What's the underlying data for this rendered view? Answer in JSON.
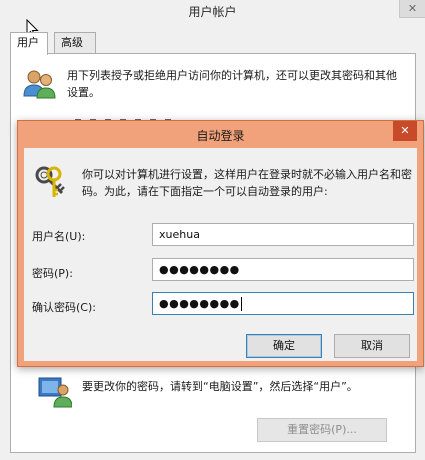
{
  "background_window": {
    "title": "用户帐户",
    "close_glyph": "✕",
    "tabs": [
      {
        "label": "用户",
        "active": true
      },
      {
        "label": "高级",
        "active": false
      }
    ],
    "info_text": "用下列表授予或拒绝用户访问你的计算机，还可以更改其密码和其他设置。",
    "password_text": "要更改你的密码，请转到“电脑设置”，然后选择“用户”。",
    "reset_button_label": "重置密码(P)..."
  },
  "dialog": {
    "title": "自动登录",
    "close_glyph": "✕",
    "description": "你可以对计算机进行设置，这样用户在登录时就不必输入用户名和密码。为此，请在下面指定一个可以自动登录的用户:",
    "fields": {
      "username": {
        "label": "用户名(U):",
        "value": "xuehua"
      },
      "password": {
        "label": "密码(P):",
        "value": "●●●●●●●●"
      },
      "confirm": {
        "label": "确认密码(C):",
        "value": "●●●●●●●●"
      }
    },
    "ok_label": "确定",
    "cancel_label": "取消"
  },
  "colors": {
    "dialog_frame": "#f2a27a",
    "dialog_close": "#c94a2a",
    "focus_border": "#3c7fb1"
  }
}
